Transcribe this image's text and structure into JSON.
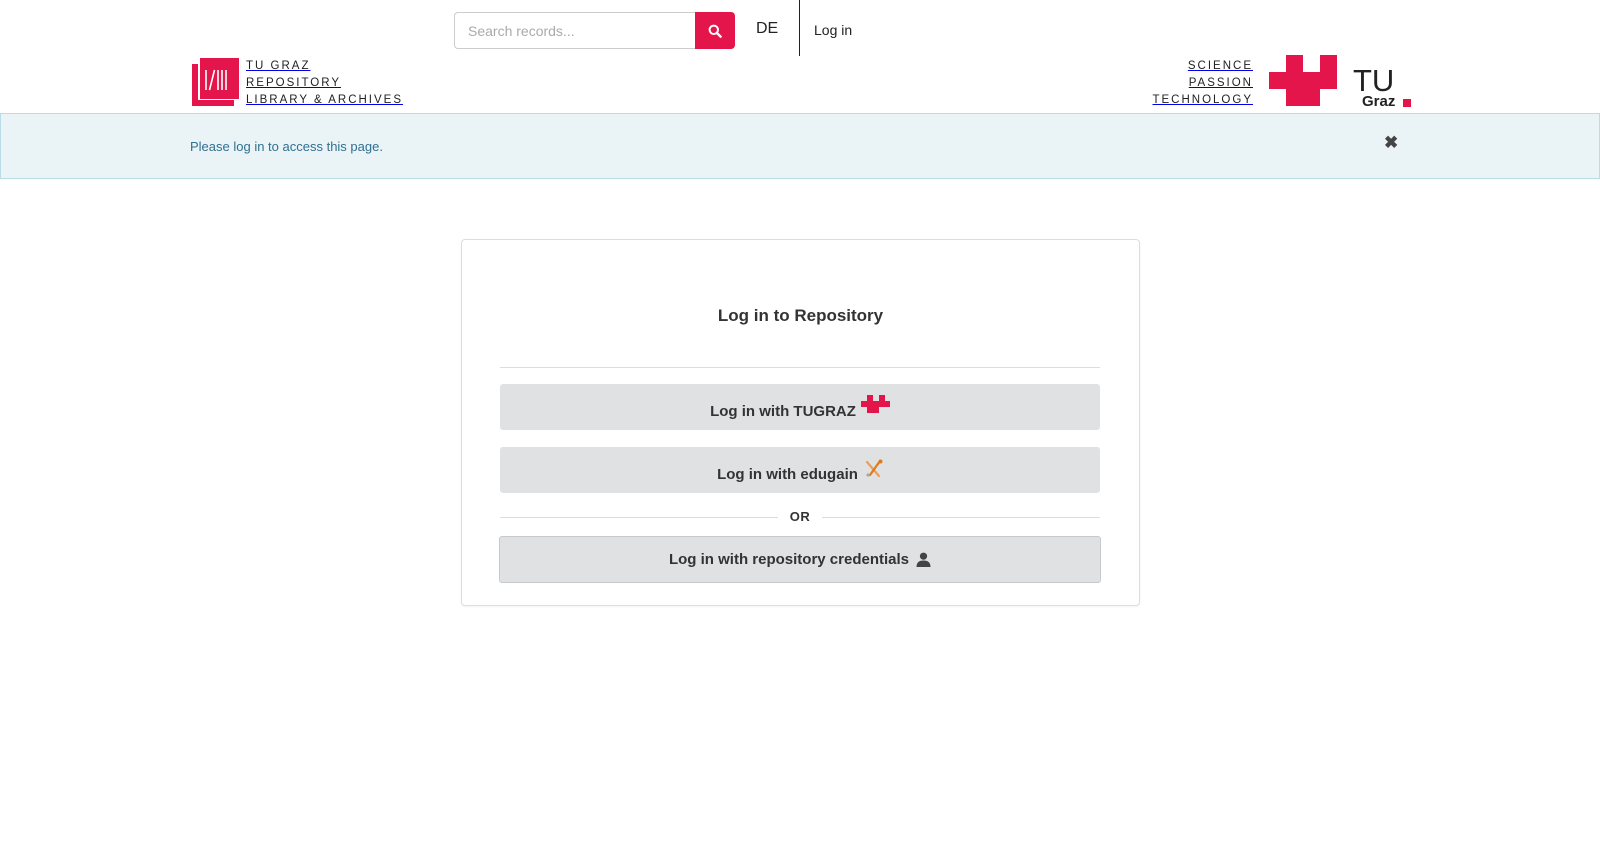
{
  "header": {
    "search": {
      "placeholder": "Search records...",
      "value": ""
    },
    "language_label": "DE",
    "login_label": "Log in",
    "brand_left": {
      "line1": "TU Graz",
      "line2": "Repository",
      "line3": "Library & Archives"
    },
    "brand_right": {
      "line1": "Science",
      "line2": "Passion",
      "line3": "Technology",
      "mark_text": "TU",
      "mark_subtext": "Graz"
    }
  },
  "alert": {
    "message": "Please log in to access this page.",
    "close_symbol": "✖"
  },
  "login": {
    "title": "Log in to Repository",
    "tugraz_label": "Log in with TUGRAZ",
    "edugain_label": "Log in with edugain",
    "or_label": "OR",
    "credentials_label": "Log in with repository credentials"
  },
  "colors": {
    "brand": "#e4154b",
    "alert_bg": "#eaf4f7",
    "alert_text": "#31708f",
    "button_bg": "#e0e1e2"
  },
  "icons": [
    "search-icon",
    "close-icon",
    "tugraz-logo-icon",
    "edugain-icon",
    "user-icon"
  ]
}
